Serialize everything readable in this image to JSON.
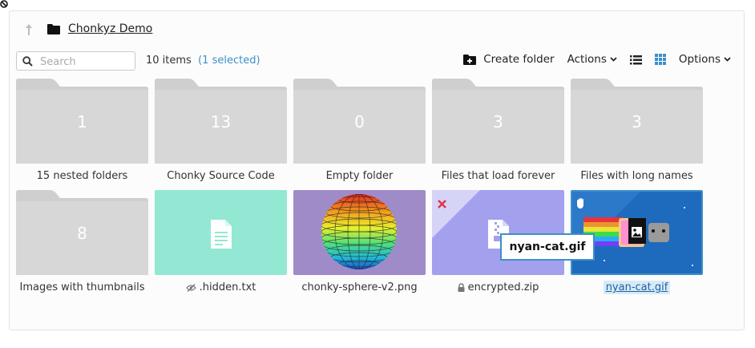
{
  "header": {
    "breadcrumb": "Chonkyz Demo"
  },
  "toolbar": {
    "search_placeholder": "Search",
    "item_count": "10 items",
    "selected_text": "1 selected",
    "create_folder": "Create folder",
    "actions": "Actions",
    "options": "Options"
  },
  "colors": {
    "accent": "#3d8fc9",
    "folder": "#d4d4d4",
    "hidden_card": "#93e8d3",
    "sphere_bg": "#a08bc9",
    "zip_card": "#a3a0ee",
    "gif_card": "#1e6bbd"
  },
  "files": [
    {
      "name": "15 nested folders",
      "type": "folder",
      "count": "1"
    },
    {
      "name": "Chonky Source Code",
      "type": "folder",
      "count": "13"
    },
    {
      "name": "Empty folder",
      "type": "folder",
      "count": "0"
    },
    {
      "name": "Files that load forever",
      "type": "folder",
      "count": "3"
    },
    {
      "name": "Files with long names",
      "type": "folder",
      "count": "3"
    },
    {
      "name": "Images with thumbnails",
      "type": "folder",
      "count": "8"
    },
    {
      "name": ".hidden.txt",
      "type": "text",
      "icon": "hidden-icon"
    },
    {
      "name": "chonky-sphere-v2.png",
      "type": "image"
    },
    {
      "name": "encrypted.zip",
      "type": "archive",
      "icon": "lock-icon"
    },
    {
      "name": "nyan-cat.gif",
      "type": "gif",
      "selected": true
    }
  ],
  "tooltip": "nyan-cat.gif"
}
